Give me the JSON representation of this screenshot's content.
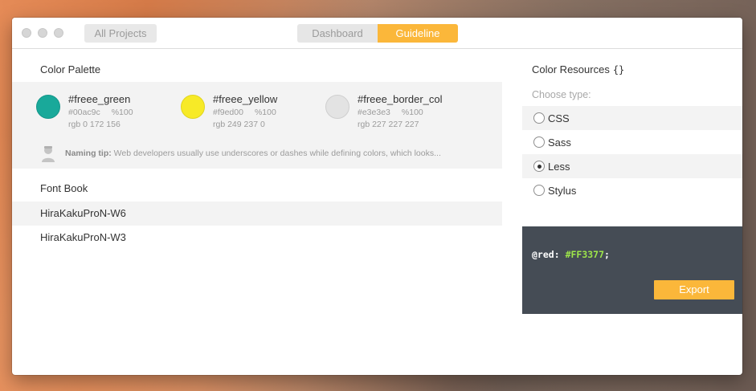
{
  "titlebar": {
    "all_projects": "All Projects",
    "tabs": [
      {
        "label": "Dashboard",
        "active": false
      },
      {
        "label": "Guideline",
        "active": true
      }
    ]
  },
  "palette": {
    "title": "Color Palette",
    "colors": [
      {
        "name": "#freee_green",
        "hex": "#00ac9c",
        "alpha": "%100",
        "rgb": "rgb 0 172 156",
        "swatch": "#19a99a"
      },
      {
        "name": "#freee_yellow",
        "hex": "#f9ed00",
        "alpha": "%100",
        "rgb": "rgb 249 237 0",
        "swatch": "#f7ea27"
      },
      {
        "name": "#freee_border_col",
        "hex": "#e3e3e3",
        "alpha": "%100",
        "rgb": "rgb 227 227 227",
        "swatch": "#e3e3e3"
      }
    ],
    "tip_label": "Naming tip:",
    "tip_text": " Web developers usually use underscores or dashes while defining colors, which looks..."
  },
  "fonts": {
    "title": "Font Book",
    "items": [
      "HiraKakuProN-W6",
      "HiraKakuProN-W3"
    ]
  },
  "resources": {
    "title": "Color Resources",
    "braces": "{}",
    "choose_label": "Choose type:",
    "types": [
      {
        "label": "CSS",
        "checked": false
      },
      {
        "label": "Sass",
        "checked": false
      },
      {
        "label": "Less",
        "checked": true
      },
      {
        "label": "Stylus",
        "checked": false
      }
    ],
    "code_var": "@red:",
    "code_val": "#FF3377",
    "code_end": ";",
    "export_label": "Export"
  },
  "colors": {
    "accent": "#fbb73a",
    "panel": "#454c55",
    "code_value": "#9ee64a"
  }
}
